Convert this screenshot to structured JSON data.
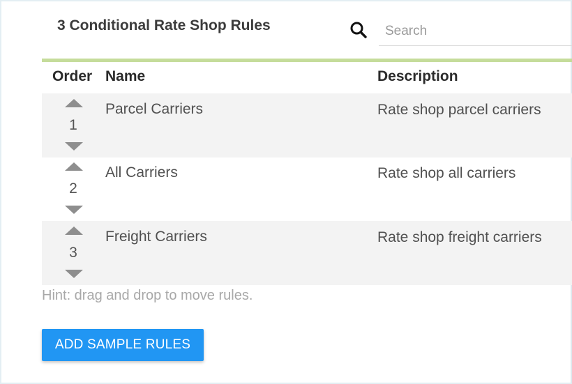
{
  "header": {
    "title": "3 Conditional Rate Shop Rules",
    "search": {
      "placeholder": "Search",
      "value": ""
    }
  },
  "table": {
    "columns": {
      "order": "Order",
      "name": "Name",
      "description": "Description"
    },
    "rows": [
      {
        "order": "1",
        "name": "Parcel Carriers",
        "description": "Rate shop parcel carriers"
      },
      {
        "order": "2",
        "name": "All Carriers",
        "description": "Rate shop all carriers"
      },
      {
        "order": "3",
        "name": "Freight Carriers",
        "description": "Rate shop freight carriers"
      }
    ]
  },
  "hint": "Hint: drag and drop to move rules.",
  "actions": {
    "add_sample_rules_label": "ADD SAMPLE RULES"
  },
  "colors": {
    "accent_button": "#2196f3",
    "divider_green": "#c5dc9b",
    "row_alt_background": "#f3f3f3",
    "arrow_gray": "#8e8e8e"
  },
  "icons": {
    "search": "search-icon",
    "move_up": "triangle-up-icon",
    "move_down": "triangle-down-icon"
  }
}
